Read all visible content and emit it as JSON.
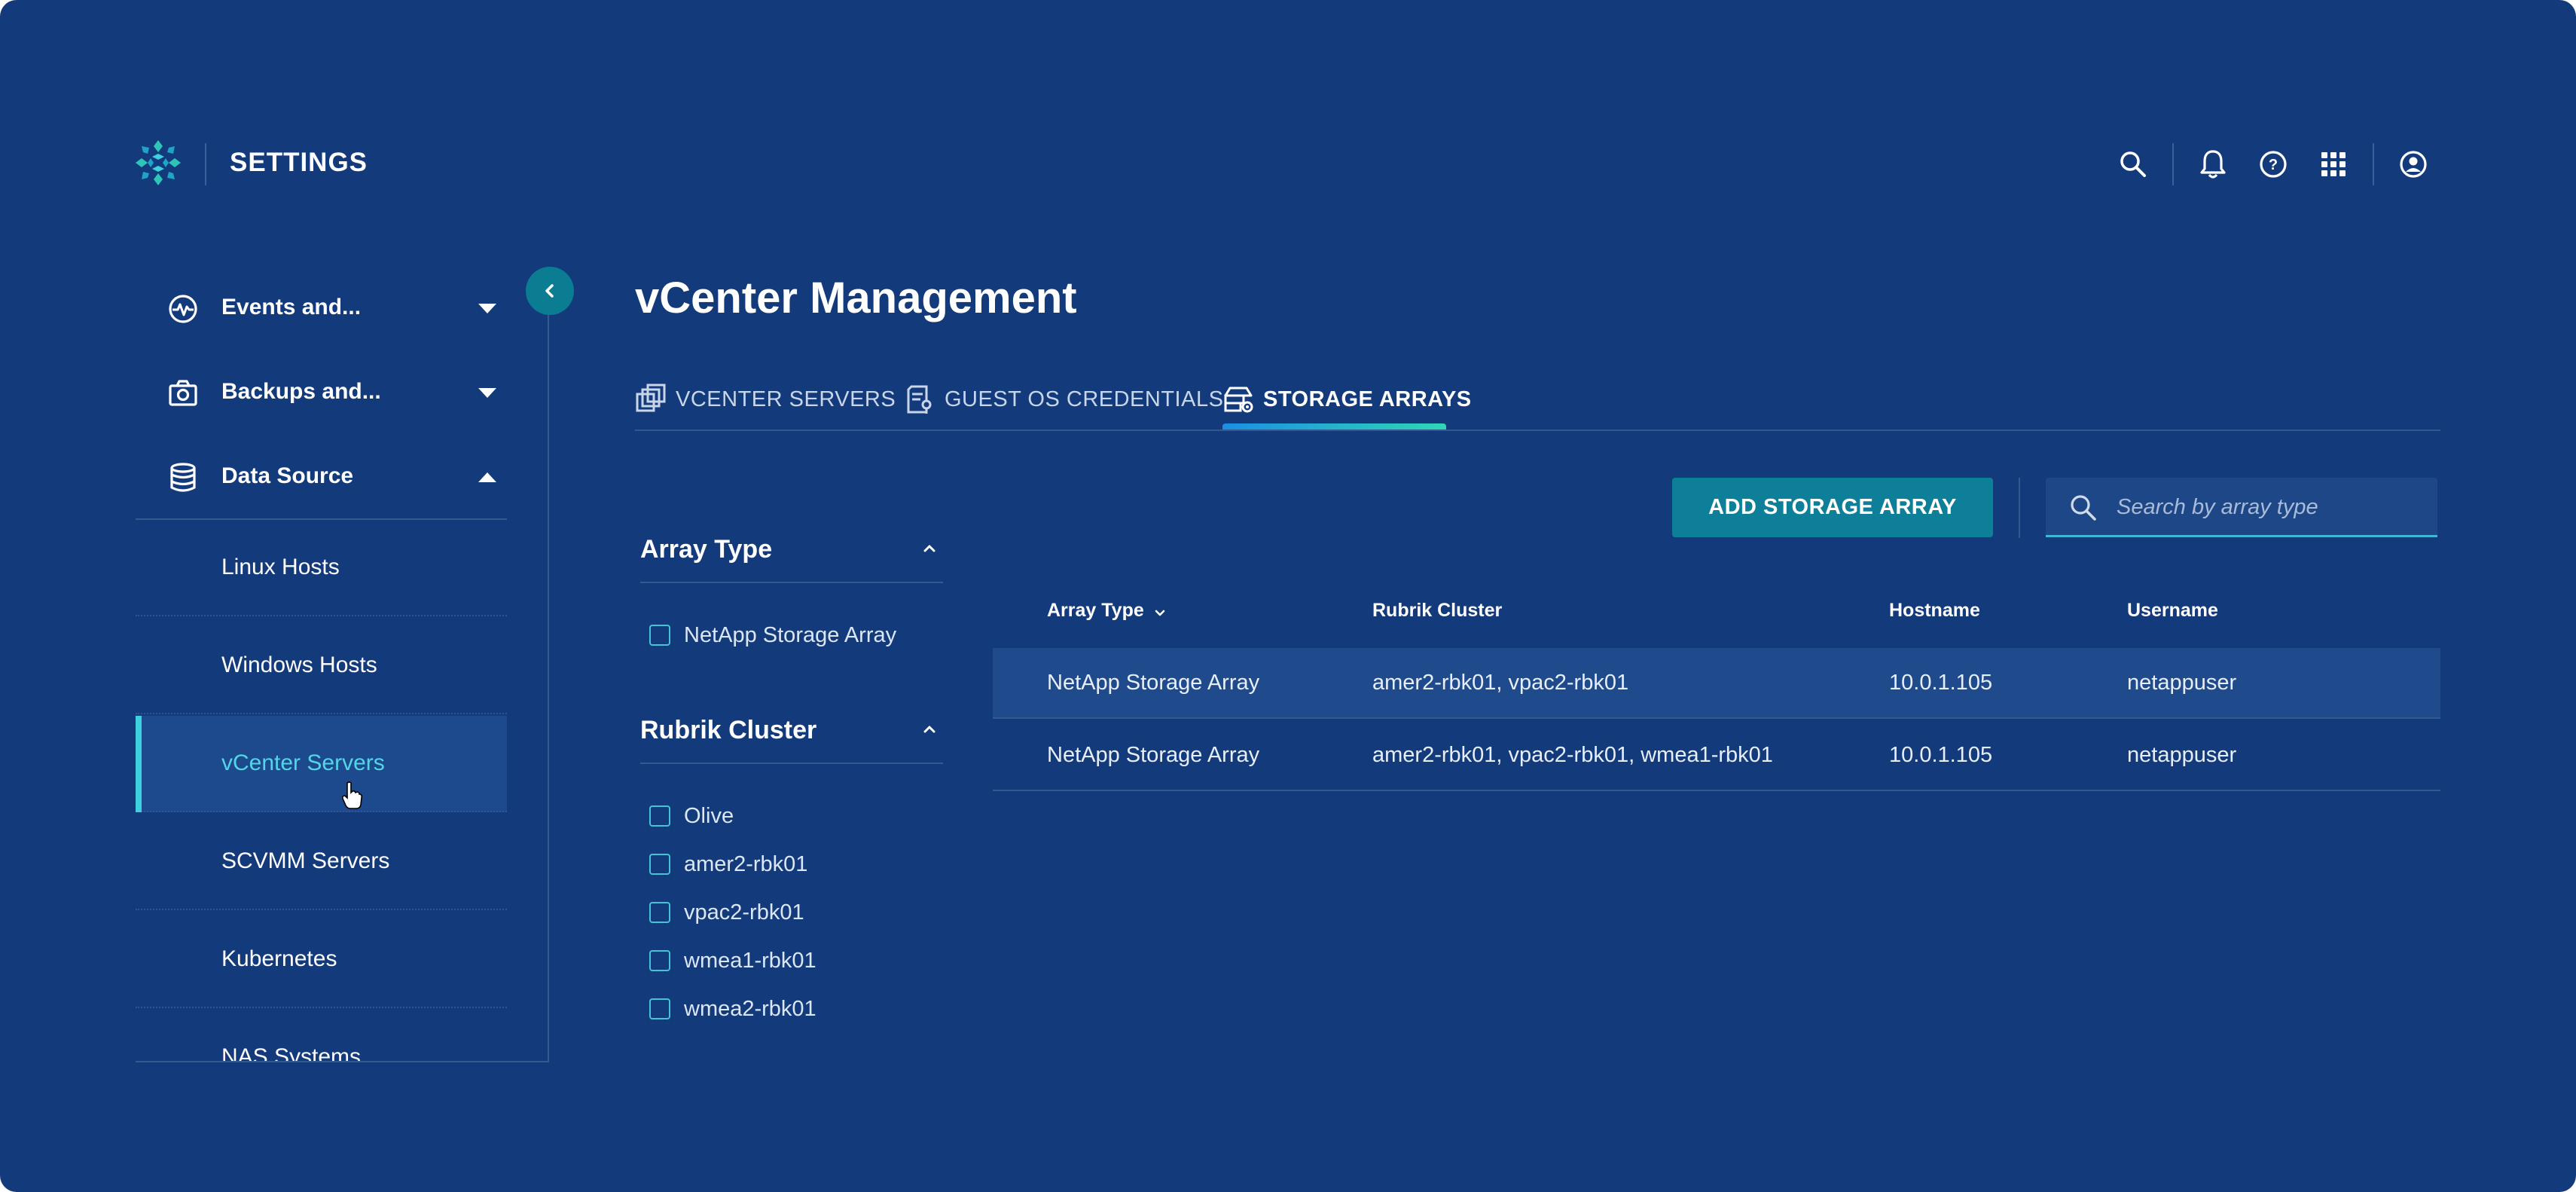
{
  "header": {
    "title": "SETTINGS",
    "icons": [
      "search-icon",
      "bell-icon",
      "help-icon",
      "apps-grid-icon",
      "user-account-icon"
    ]
  },
  "sidebar": {
    "groups": [
      {
        "label": "Events and...",
        "icon": "activity-icon",
        "expanded": false
      },
      {
        "label": "Backups and...",
        "icon": "camera-icon",
        "expanded": false
      },
      {
        "label": "Data Source",
        "icon": "database-icon",
        "expanded": true
      }
    ],
    "items": [
      {
        "label": "Linux Hosts"
      },
      {
        "label": "Windows Hosts"
      },
      {
        "label": "vCenter Servers",
        "active": true
      },
      {
        "label": "SCVMM Servers"
      },
      {
        "label": "Kubernetes"
      },
      {
        "label": "NAS Systems"
      }
    ]
  },
  "main": {
    "title": "vCenter Management",
    "tabs": [
      {
        "label": "VCENTER SERVERS",
        "icon": "servers-icon"
      },
      {
        "label": "GUEST OS CREDENTIALS",
        "icon": "credentials-icon"
      },
      {
        "label": "STORAGE ARRAYS",
        "icon": "storage-array-icon",
        "active": true
      }
    ],
    "add_button": "ADD STORAGE ARRAY",
    "search": {
      "placeholder": "Search by array type",
      "value": ""
    },
    "filters": [
      {
        "title": "Array Type",
        "options": [
          "NetApp Storage Array"
        ]
      },
      {
        "title": "Rubrik Cluster",
        "options": [
          "Olive",
          "amer2-rbk01",
          "vpac2-rbk01",
          "wmea1-rbk01",
          "wmea2-rbk01"
        ]
      }
    ],
    "table": {
      "columns": [
        "Array Type",
        "Rubrik Cluster",
        "Hostname",
        "Username"
      ],
      "rows": [
        [
          "NetApp Storage Array",
          "amer2-rbk01,  vpac2-rbk01",
          "10.0.1.105",
          "netappuser"
        ],
        [
          "NetApp Storage Array",
          "amer2-rbk01,  vpac2-rbk01, wmea1-rbk01",
          "10.0.1.105",
          "netappuser"
        ]
      ]
    }
  },
  "colors": {
    "background": "#133b7c",
    "accent": "#0e7f98",
    "active_text": "#52d6e6",
    "highlight_row": "#1f4a8c"
  }
}
